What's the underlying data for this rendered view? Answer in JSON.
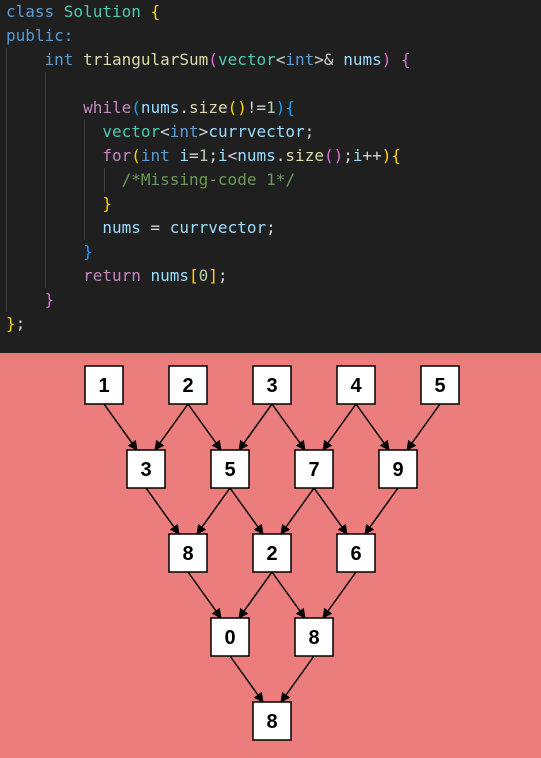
{
  "code": {
    "lines": [
      [
        {
          "t": "class ",
          "c": "kw"
        },
        {
          "t": "Solution ",
          "c": "ty"
        },
        {
          "t": "{",
          "c": "b1"
        }
      ],
      [
        {
          "t": "public:",
          "c": "kw"
        }
      ],
      [
        {
          "t": "    "
        },
        {
          "t": "int ",
          "c": "kw"
        },
        {
          "t": "triangularSum",
          "c": "fn"
        },
        {
          "t": "(",
          "c": "b2"
        },
        {
          "t": "vector",
          "c": "ty"
        },
        {
          "t": "<"
        },
        {
          "t": "int",
          "c": "kw"
        },
        {
          "t": ">& "
        },
        {
          "t": "nums",
          "c": "var"
        },
        {
          "t": ") ",
          "c": "b2"
        },
        {
          "t": "{",
          "c": "b2"
        }
      ],
      [],
      [
        {
          "t": "        "
        },
        {
          "t": "while",
          "c": "ctl"
        },
        {
          "t": "(",
          "c": "b3"
        },
        {
          "t": "nums",
          "c": "var"
        },
        {
          "t": "."
        },
        {
          "t": "size",
          "c": "fn"
        },
        {
          "t": "()",
          "c": "b1"
        },
        {
          "t": "!="
        },
        {
          "t": "1",
          "c": "num"
        },
        {
          "t": ")",
          "c": "b3"
        },
        {
          "t": "{",
          "c": "b3"
        }
      ],
      [
        {
          "t": "          "
        },
        {
          "t": "vector",
          "c": "ty"
        },
        {
          "t": "<"
        },
        {
          "t": "int",
          "c": "kw"
        },
        {
          "t": ">"
        },
        {
          "t": "currvector",
          "c": "var"
        },
        {
          "t": ";"
        }
      ],
      [
        {
          "t": "          "
        },
        {
          "t": "for",
          "c": "ctl"
        },
        {
          "t": "(",
          "c": "b1"
        },
        {
          "t": "int ",
          "c": "kw"
        },
        {
          "t": "i",
          "c": "var"
        },
        {
          "t": "="
        },
        {
          "t": "1",
          "c": "num"
        },
        {
          "t": ";"
        },
        {
          "t": "i",
          "c": "var"
        },
        {
          "t": "<"
        },
        {
          "t": "nums",
          "c": "var"
        },
        {
          "t": "."
        },
        {
          "t": "size",
          "c": "fn"
        },
        {
          "t": "()",
          "c": "b2"
        },
        {
          "t": ";"
        },
        {
          "t": "i",
          "c": "var"
        },
        {
          "t": "++"
        },
        {
          "t": ")",
          "c": "b1"
        },
        {
          "t": "{",
          "c": "b1"
        }
      ],
      [
        {
          "t": "            "
        },
        {
          "t": "/*Missing-code 1*/",
          "c": "cmt"
        }
      ],
      [
        {
          "t": "          "
        },
        {
          "t": "}",
          "c": "b1"
        }
      ],
      [
        {
          "t": "          "
        },
        {
          "t": "nums",
          "c": "var"
        },
        {
          "t": " = "
        },
        {
          "t": "currvector",
          "c": "var"
        },
        {
          "t": ";"
        }
      ],
      [
        {
          "t": "        "
        },
        {
          "t": "}",
          "c": "b3"
        }
      ],
      [
        {
          "t": "        "
        },
        {
          "t": "return ",
          "c": "ctl"
        },
        {
          "t": "nums",
          "c": "var"
        },
        {
          "t": "[",
          "c": "b1"
        },
        {
          "t": "0",
          "c": "num"
        },
        {
          "t": "]",
          "c": "b1"
        },
        {
          "t": ";"
        }
      ],
      [
        {
          "t": "    "
        },
        {
          "t": "}",
          "c": "b2"
        }
      ],
      [
        {
          "t": "}",
          "c": "b1"
        },
        {
          "t": ";"
        }
      ]
    ]
  },
  "diagram": {
    "background": "#ec7d7d",
    "rows": [
      [
        "1",
        "2",
        "3",
        "4",
        "5"
      ],
      [
        "3",
        "5",
        "7",
        "9"
      ],
      [
        "8",
        "2",
        "6"
      ],
      [
        "0",
        "8"
      ],
      [
        "8"
      ]
    ]
  }
}
